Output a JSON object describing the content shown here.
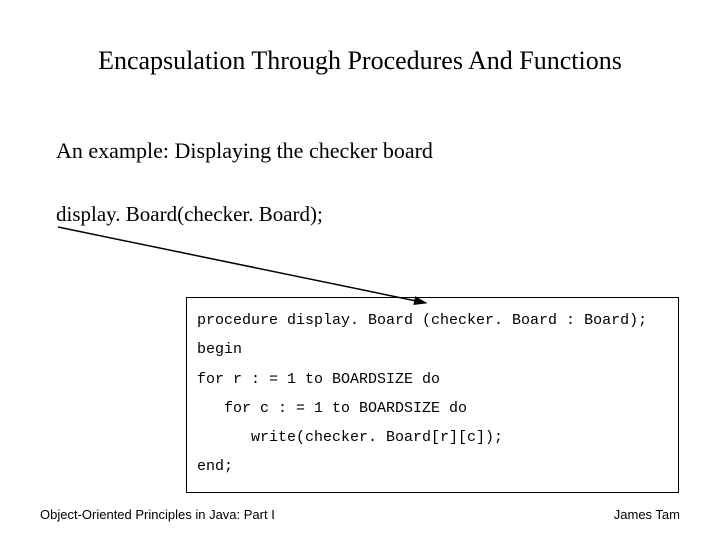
{
  "title": "Encapsulation Through Procedures And Functions",
  "subhead": "An example: Displaying the checker board",
  "call": "display. Board(checker. Board);",
  "code": {
    "l1": "procedure display. Board (checker. Board : Board);",
    "l2": "begin",
    "l3": "for r : = 1 to BOARDSIZE do",
    "l4": "   for c : = 1 to BOARDSIZE do",
    "l5": "      write(checker. Board[r][c]);",
    "l6": "end;"
  },
  "footer": {
    "left": "Object-Oriented Principles in Java: Part I",
    "right": "James Tam"
  }
}
